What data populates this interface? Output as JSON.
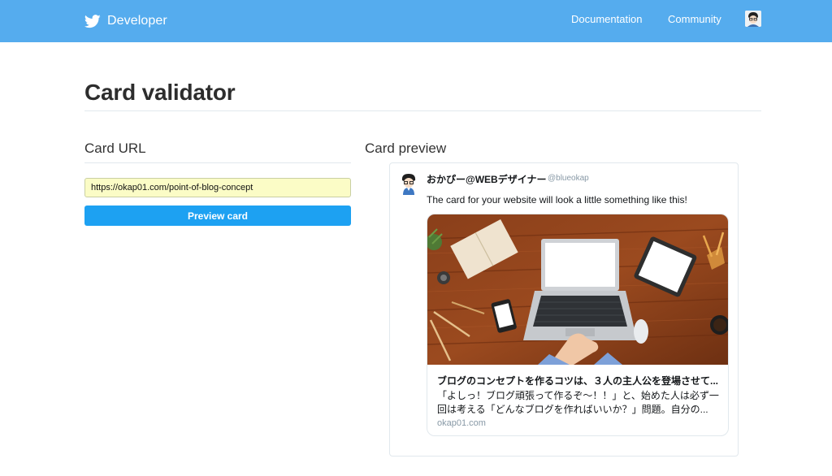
{
  "header": {
    "brand_label": "Developer",
    "nav": [
      {
        "label": "Documentation"
      },
      {
        "label": "Community"
      }
    ],
    "accent_color": "#55acee"
  },
  "page": {
    "title": "Card validator"
  },
  "card_url": {
    "section_label": "Card URL",
    "input_value": "https://okap01.com/point-of-blog-concept",
    "button_label": "Preview card"
  },
  "preview": {
    "section_label": "Card preview",
    "tweet": {
      "name": "おかぴー@WEBデザイナー",
      "handle": "@blueokap",
      "text": "The card for your website will look a little something like this!"
    },
    "card": {
      "title": "ブログのコンセプトを作るコツは、３人の主人公を登場させて...",
      "description_line1": "「よしっ！ブログ頑張って作るぞ〜！！」と、始めた人は必ず一",
      "description_line2": "回は考える「どんなブログを作ればいいか？」問題。自分の...",
      "domain": "okap01.com"
    }
  }
}
